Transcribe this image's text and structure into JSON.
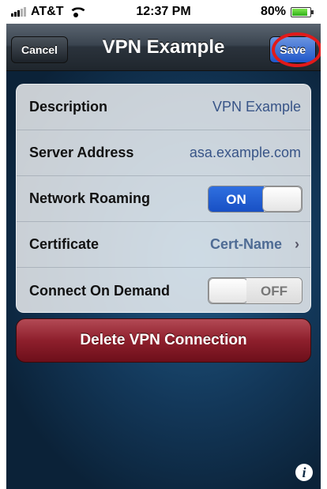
{
  "status_bar": {
    "carrier": "AT&T",
    "time": "12:37 PM",
    "battery": "80%"
  },
  "nav": {
    "cancel_label": "Cancel",
    "title": "VPN Example",
    "save_label": "Save"
  },
  "fields": {
    "description": {
      "label": "Description",
      "value": "VPN Example"
    },
    "server_address": {
      "label": "Server Address",
      "value": "asa.example.com"
    },
    "network_roaming": {
      "label": "Network Roaming",
      "state": "ON"
    },
    "certificate": {
      "label": "Certificate",
      "value": "Cert-Name"
    },
    "connect_on_demand": {
      "label": "Connect On Demand",
      "state": "OFF"
    }
  },
  "delete_label": "Delete VPN Connection",
  "colors": {
    "save_highlight": "#e21a1a",
    "delete_button": "#8e1f2c",
    "toggle_on": "#2f6fe0"
  }
}
